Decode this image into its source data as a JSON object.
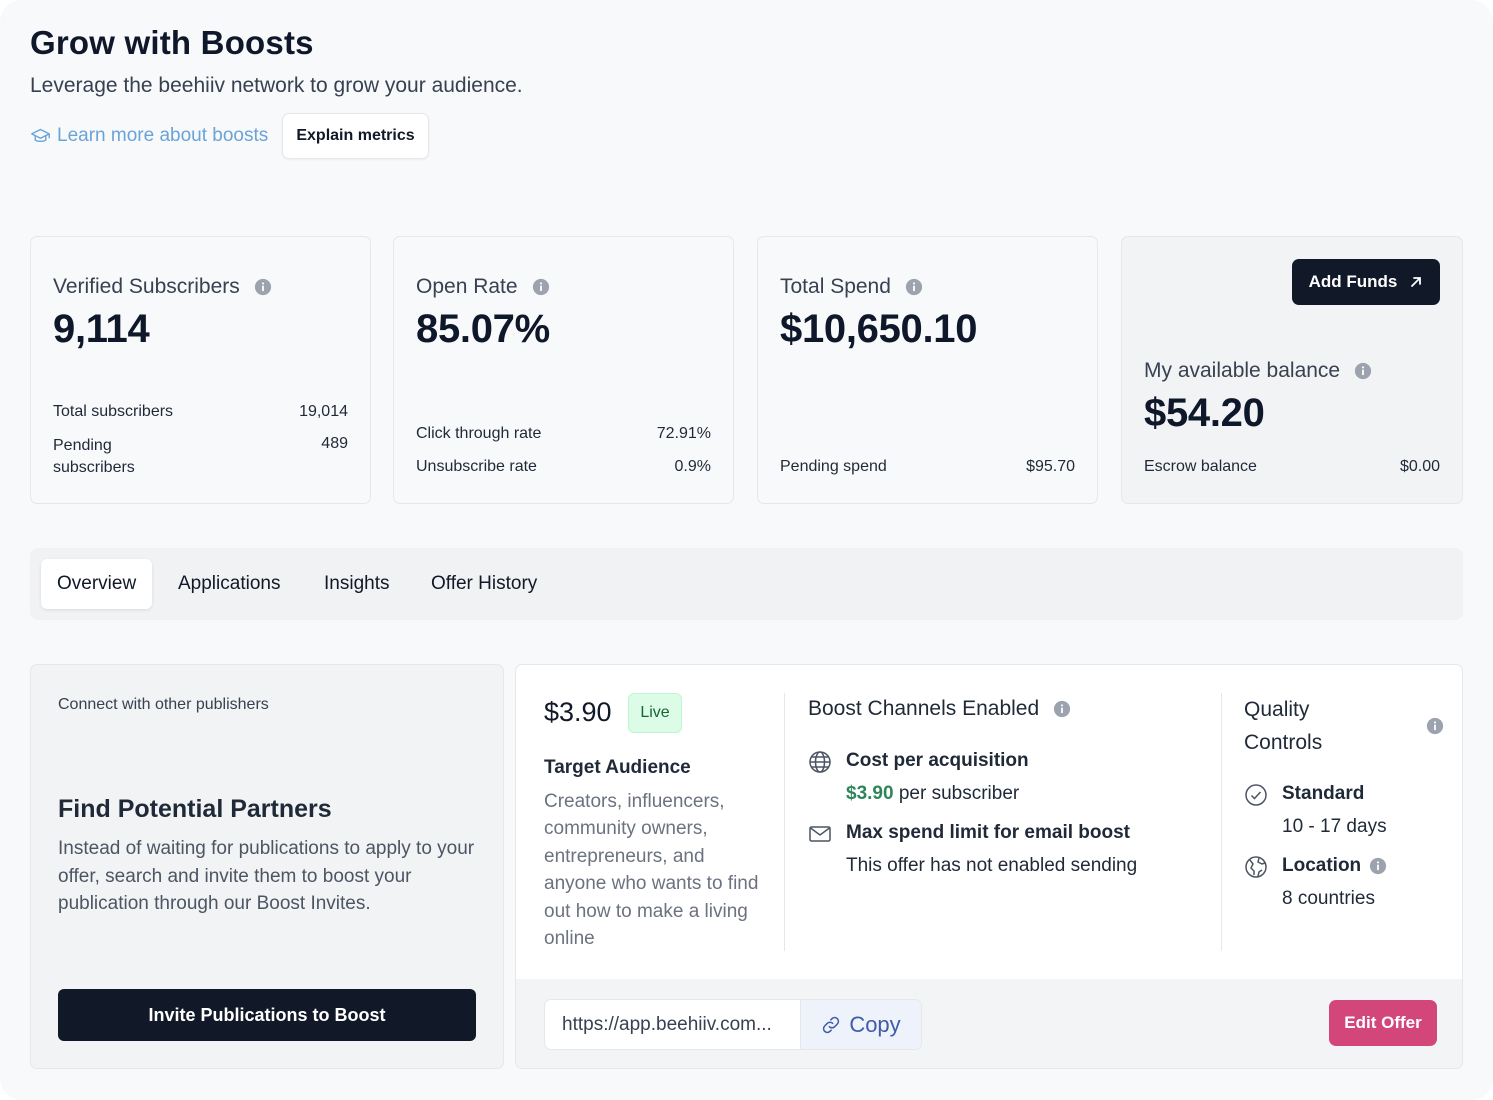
{
  "header": {
    "title": "Grow with Boosts",
    "subtitle": "Leverage the beehiiv network to grow your audience.",
    "learn_more": "Learn more about boosts",
    "explain_metrics": "Explain metrics"
  },
  "cards": {
    "verified": {
      "label": "Verified Subscribers",
      "value": "9,114",
      "rows": [
        {
          "label": "Total subscribers",
          "value": "19,014"
        },
        {
          "label": "Pending subscribers",
          "value": "489"
        }
      ]
    },
    "open_rate": {
      "label": "Open Rate",
      "value": "85.07%",
      "rows": [
        {
          "label": "Click through rate",
          "value": "72.91%"
        },
        {
          "label": "Unsubscribe rate",
          "value": "0.9%"
        }
      ]
    },
    "total_spend": {
      "label": "Total Spend",
      "value": "$10,650.10",
      "rows": [
        {
          "label": "Pending spend",
          "value": "$95.70"
        }
      ]
    },
    "balance": {
      "add_funds": "Add Funds",
      "label": "My available balance",
      "value": "$54.20",
      "rows": [
        {
          "label": "Escrow balance",
          "value": "$0.00"
        }
      ]
    }
  },
  "tabs": [
    "Overview",
    "Applications",
    "Insights",
    "Offer History"
  ],
  "active_tab": "Overview",
  "partner": {
    "eyebrow": "Connect with other publishers",
    "heading": "Find Potential Partners",
    "description": "Instead of waiting for publications to apply to your offer, search and invite them to boost your publication through our Boost Invites.",
    "button": "Invite Publications to Boost"
  },
  "offer": {
    "price": "$3.90",
    "status": "Live",
    "target_label": "Target Audience",
    "target_desc": "Creators, influencers, community owners, entrepreneurs, and anyone who wants to find out how to make a living online",
    "channels": {
      "heading": "Boost Channels Enabled",
      "cpa_title": "Cost per acquisition",
      "cpa_amount": "$3.90",
      "cpa_suffix": "per subscriber",
      "email_title": "Max spend limit for email boost",
      "email_desc": "This offer has not enabled sending"
    },
    "quality": {
      "heading": "Quality Controls",
      "standard_title": "Standard",
      "standard_desc": "10 - 17 days",
      "location_title": "Location",
      "location_desc": "8 countries"
    },
    "url": "https://app.beehiiv.com...",
    "copy": "Copy",
    "edit": "Edit Offer"
  },
  "colors": {
    "accent_dark": "#111827",
    "edit_offer": "#d2467a",
    "live_green": "#166534",
    "link_blue": "#6aa3d8"
  }
}
